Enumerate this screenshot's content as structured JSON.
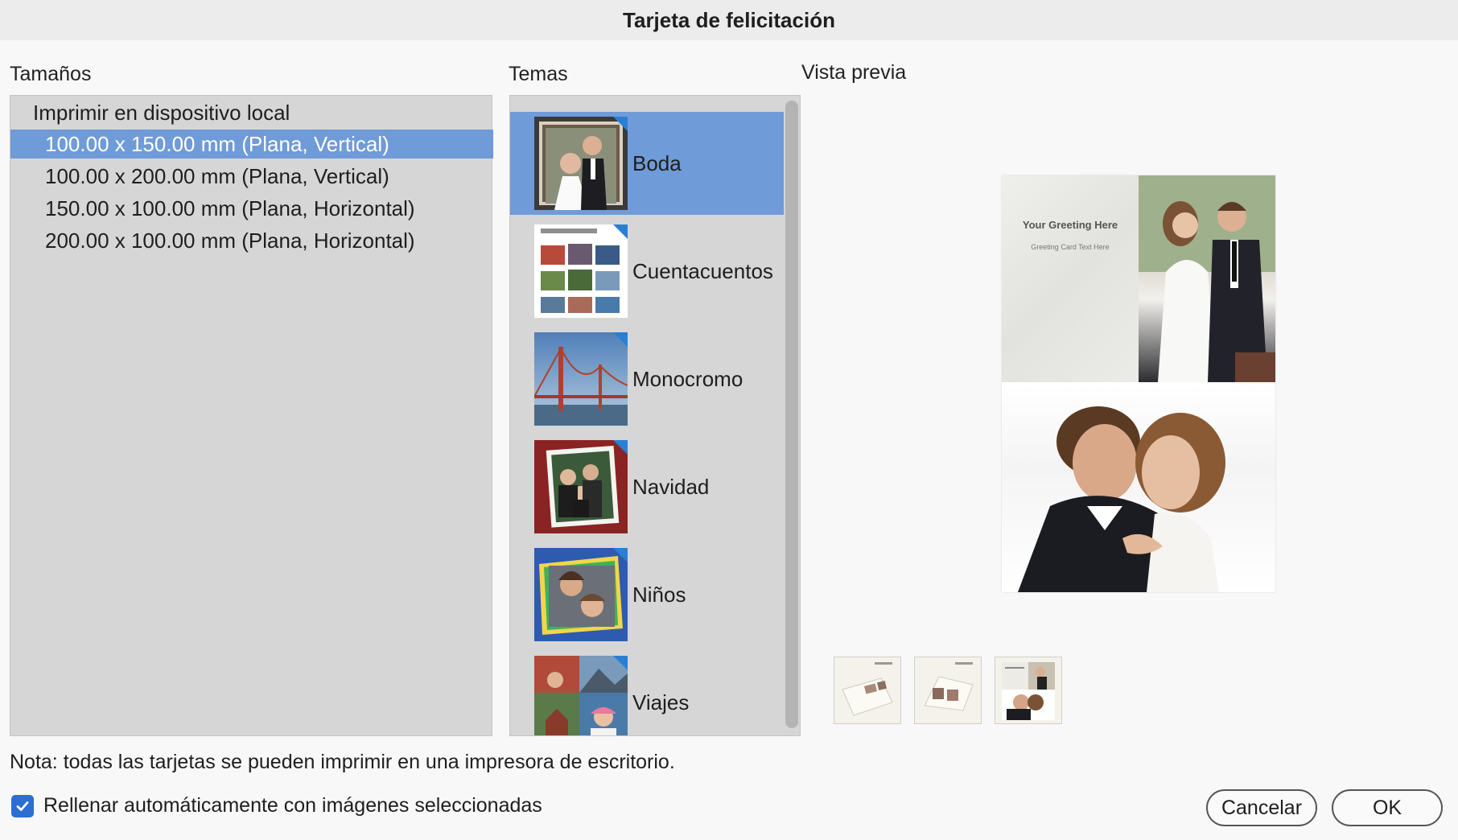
{
  "window": {
    "title": "Tarjeta de felicitación"
  },
  "sections": {
    "sizes": "Tamaños",
    "themes": "Temas",
    "preview": "Vista previa"
  },
  "sizes": {
    "group": "Imprimir en dispositivo local",
    "items": [
      {
        "label": "100.00 x 150.00 mm (Plana, Vertical)",
        "selected": true
      },
      {
        "label": "100.00 x 200.00 mm (Plana, Vertical)",
        "selected": false
      },
      {
        "label": "150.00 x 100.00 mm (Plana, Horizontal)",
        "selected": false
      },
      {
        "label": "200.00 x 100.00 mm (Plana, Horizontal)",
        "selected": false
      }
    ]
  },
  "themes": {
    "items": [
      {
        "label": "Boda",
        "icon": "wedding-thumbnail",
        "selected": true
      },
      {
        "label": "Cuentacuentos",
        "icon": "storybook-thumbnail",
        "selected": false
      },
      {
        "label": "Monocromo",
        "icon": "golden-gate-thumbnail",
        "selected": false
      },
      {
        "label": "Navidad",
        "icon": "christmas-thumbnail",
        "selected": false
      },
      {
        "label": "Niños",
        "icon": "kids-thumbnail",
        "selected": false
      },
      {
        "label": "Viajes",
        "icon": "travel-thumbnail",
        "selected": false
      }
    ]
  },
  "preview": {
    "greeting": "Your Greeting Here",
    "greeting_sub": "Greeting Card Text Here",
    "thumbnails": [
      "preview-view-1",
      "preview-view-2",
      "preview-view-3"
    ]
  },
  "note": "Nota: todas las tarjetas se pueden imprimir en una impresora de escritorio.",
  "autofill": {
    "label": "Rellenar automáticamente con imágenes seleccionadas",
    "checked": true
  },
  "buttons": {
    "cancel": "Cancelar",
    "ok": "OK"
  },
  "colors": {
    "selection": "#6f9bd8",
    "checkbox": "#2b6fd1",
    "panel": "#d6d6d6"
  }
}
